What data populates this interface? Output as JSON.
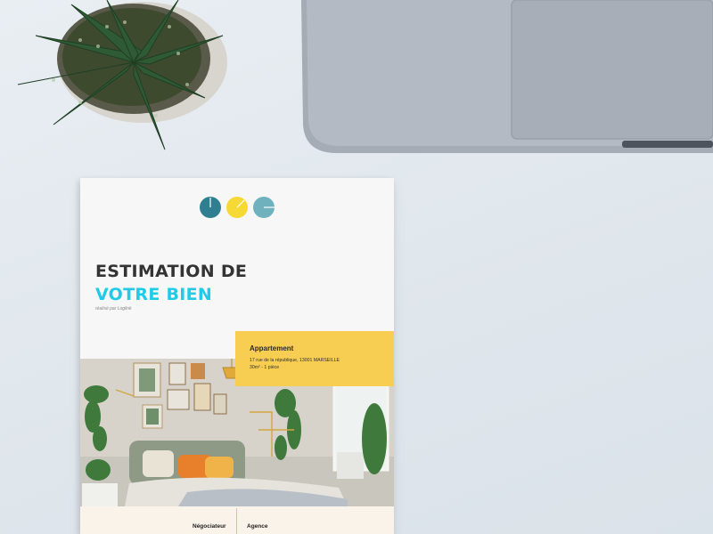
{
  "brochure": {
    "title_line1": "ESTIMATION DE",
    "title_line2": "VOTRE BIEN",
    "byline": "réalisé par Loglink",
    "property": {
      "type": "Appartement",
      "address": "17 rue de la république, 13001 MARSEILLE",
      "details": "30m² - 1 pièce"
    },
    "footer": {
      "negotiator_label": "Négociateur",
      "agency_label": "Agence"
    }
  },
  "colors": {
    "accent_cyan": "#1fcbe6",
    "accent_yellow": "#f7cd52",
    "logo_teal": "#2f7f90",
    "logo_light_teal": "#6fb2bd",
    "desk": "#e3e9ee"
  }
}
